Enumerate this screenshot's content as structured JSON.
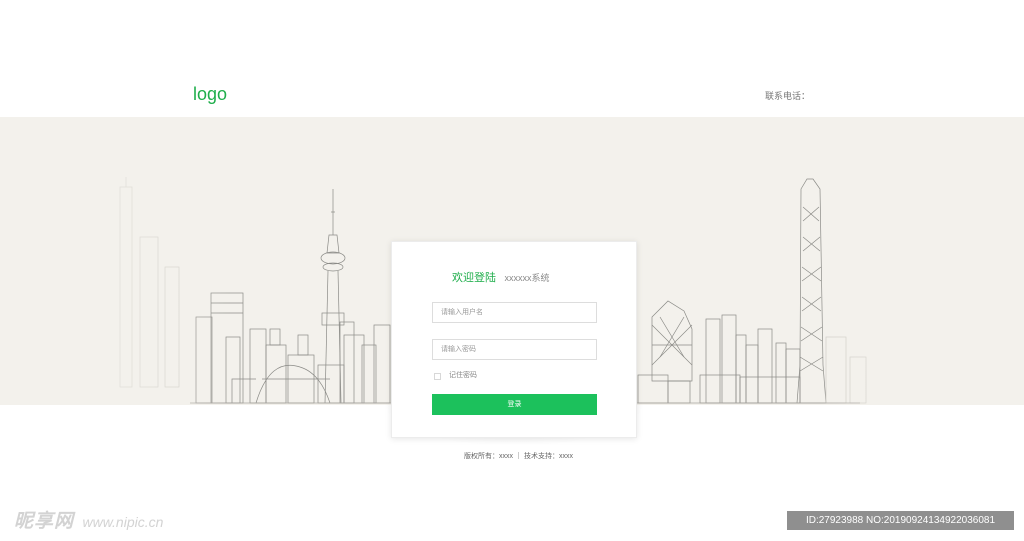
{
  "header": {
    "logo_text": "logo",
    "contact_label": "联系电话："
  },
  "login": {
    "welcome": "欢迎登陆",
    "system_name": "xxxxxx系统",
    "username_placeholder": "请输入用户名",
    "password_placeholder": "请输入密码",
    "remember_label": "记住密码",
    "remember_checked": false,
    "submit_label": "登录"
  },
  "footer": {
    "copyright": "版权所有：xxxx",
    "support": "技术支持：xxxx"
  },
  "watermark": {
    "brand": "昵享网",
    "url": "www.nipic.cn",
    "id": "ID:27923988 NO:20190924134922036081"
  },
  "colors": {
    "accent_green": "#1cc15c",
    "logo_green": "#1fae4b",
    "banner_bg": "#f3f1ec"
  }
}
